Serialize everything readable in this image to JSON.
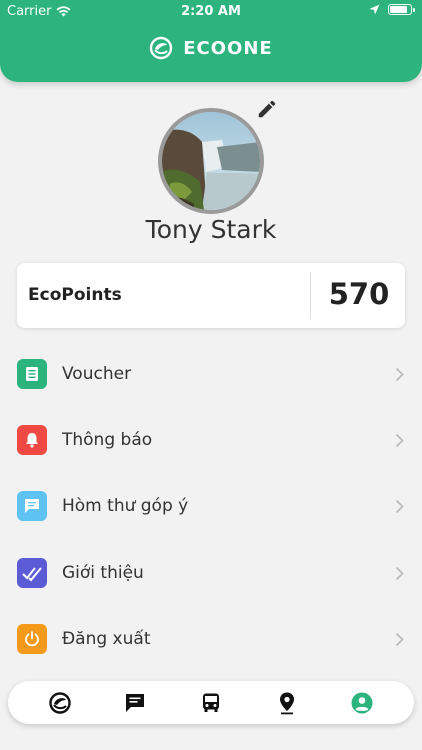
{
  "status_bar": {
    "carrier": "Carrier",
    "time": "2:20 AM"
  },
  "header": {
    "brand": "ECOONE"
  },
  "profile": {
    "name": "Tony Stark"
  },
  "points": {
    "label": "EcoPoints",
    "value": "570"
  },
  "menu": [
    {
      "label": "Voucher",
      "icon": "voucher-icon",
      "color": "#2db37d"
    },
    {
      "label": "Thông báo",
      "icon": "bell-icon",
      "color": "#f04a45"
    },
    {
      "label": "Hòm thư góp ý",
      "icon": "feedback-icon",
      "color": "#5ec3f1"
    },
    {
      "label": "Giới thiệu",
      "icon": "double-check-icon",
      "color": "#5b5bd6"
    },
    {
      "label": "Đăng xuất",
      "icon": "power-icon",
      "color": "#f49a1a"
    }
  ],
  "tabbar": {
    "tabs": [
      "home-logo-icon",
      "chat-icon",
      "bus-icon",
      "location-pin-icon",
      "profile-icon"
    ],
    "active": "profile-icon",
    "active_color": "#2db37d",
    "inactive_color": "#111111"
  },
  "colors": {
    "brand_green": "#2db37d",
    "background": "#f2f2f2"
  }
}
